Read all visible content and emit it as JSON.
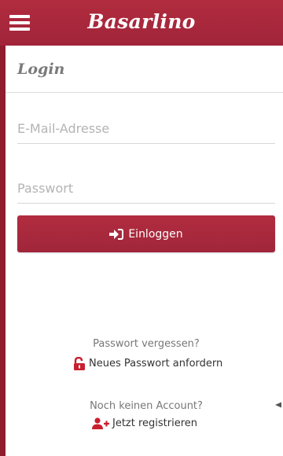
{
  "header": {
    "brand": "Basarlino",
    "menu_icon": "hamburger-menu-icon"
  },
  "page": {
    "title": "Login"
  },
  "form": {
    "email_placeholder": "E-Mail-Adresse",
    "password_placeholder": "Passwort",
    "login_label": "Einloggen",
    "login_icon": "sign-in-icon"
  },
  "links": {
    "forgot_question": "Passwort vergessen?",
    "forgot_link": "Neues Passwort anfordern",
    "forgot_icon": "unlock-icon",
    "no_account_question": "Noch keinen Account?",
    "register_link": "Jetzt registrieren",
    "register_icon": "user-plus-icon"
  },
  "colors": {
    "brand": "#a8283c",
    "placeholder": "#b4b4b4",
    "muted_text": "#777777"
  }
}
